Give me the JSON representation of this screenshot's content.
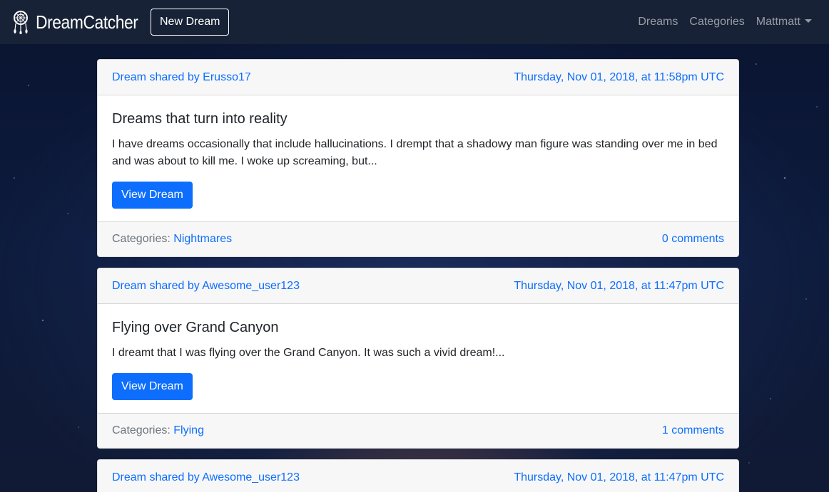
{
  "navbar": {
    "brand": "DreamCatcher",
    "new_dream_label": "New Dream",
    "links": [
      "Dreams",
      "Categories"
    ],
    "user_menu_label": "Mattmatt"
  },
  "dreams": [
    {
      "shared_by": "Dream shared by Erusso17",
      "date": "Thursday, Nov 01, 2018, at 11:58pm UTC",
      "title": "Dreams that turn into reality",
      "excerpt": "I have dreams occasionally that include hallucinations. I drempt that a shadowy man figure was standing over me in bed and was about to kill me. I woke up screaming, but...",
      "view_label": "View Dream",
      "categories_label": "Categories:",
      "category": "Nightmares",
      "comments": "0 comments"
    },
    {
      "shared_by": "Dream shared by Awesome_user123",
      "date": "Thursday, Nov 01, 2018, at 11:47pm UTC",
      "title": "Flying over Grand Canyon",
      "excerpt": "I dreamt that I was flying over the Grand Canyon. It was such a vivid dream!...",
      "view_label": "View Dream",
      "categories_label": "Categories:",
      "category": "Flying",
      "comments": "1 comments"
    },
    {
      "shared_by": "Dream shared by Awesome_user123",
      "date": "Thursday, Nov 01, 2018, at 11:47pm UTC"
    }
  ],
  "colors": {
    "navbar_bg": "#172236",
    "link": "#0d6efd",
    "primary_button": "#0d6efd"
  }
}
